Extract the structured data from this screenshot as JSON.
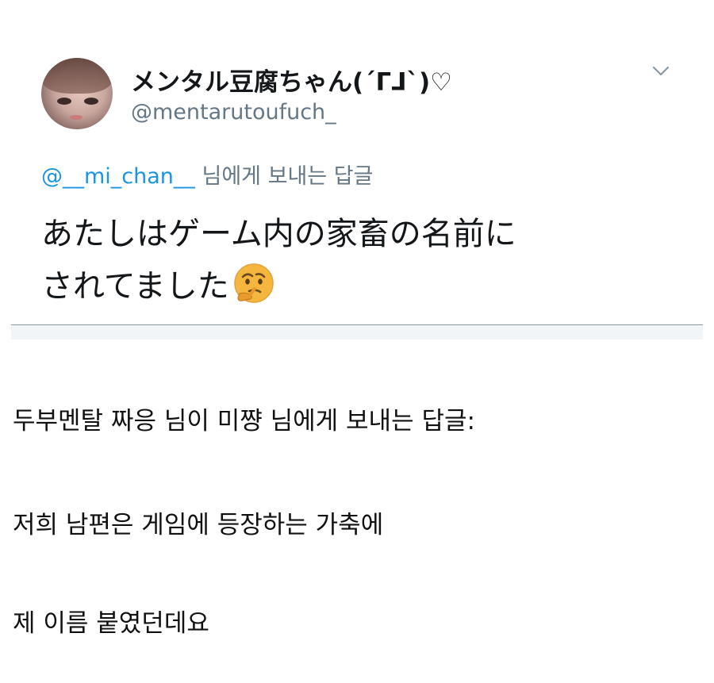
{
  "tweet": {
    "display_name": "メンタル豆腐ちゃん(´ᒥᒧ`)♡",
    "handle": "@mentarutoufuch_",
    "reply_to": {
      "mention": "@__mi_chan__",
      "suffix": " 님에게 보내는 답글"
    },
    "text_line1": "あたしはゲーム内の家畜の名前に",
    "text_line2": "されてました",
    "emoji": "thinking-face-icon",
    "menu_icon": "chevron-down-icon"
  },
  "translation": {
    "line1": "두부멘탈 짜응 님이 미쨩 님에게 보내는 답글:",
    "line2": "저희 남편은 게임에 등장하는 가축에",
    "line3": "제 이름 붙였던데요"
  },
  "colors": {
    "link": "#1b95e0",
    "secondary_text": "#657786",
    "primary_text": "#14171a",
    "divider": "#8899a6"
  }
}
